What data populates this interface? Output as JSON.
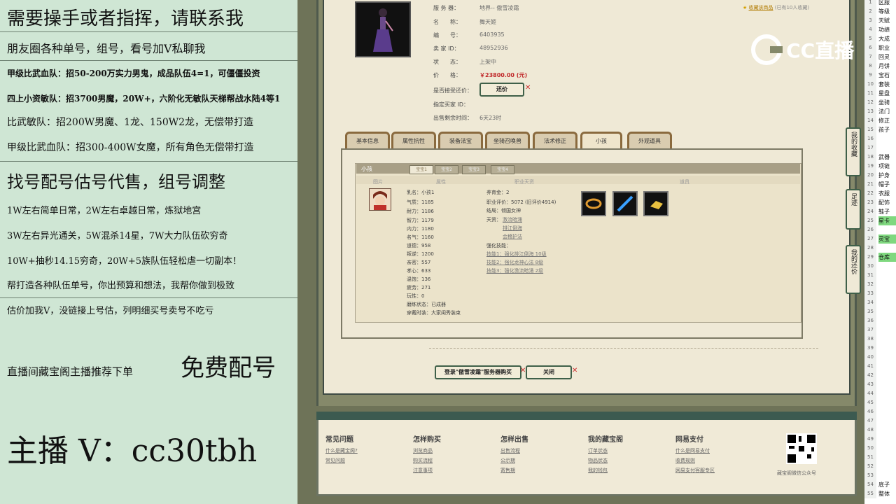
{
  "overlay": {
    "lines": [
      "需要操手或者指挥，请联系我",
      "朋友圈各种单号，组号，看号加V私聊我",
      "甲级比武血队：招50-200万实力男鬼，成品队伍4=1，可僵僵投资",
      "四上小资敏队：招3700男魔，20W+，六阶化无敏队天梯帮战水陆4等1",
      "比武敏队：招200W男魔、1龙、150W2龙，无偿带打造",
      "甲级比武血队：招300-400W女魔，所有角色无偿带打造",
      "找号配号估号代售，组号调整",
      "1W左右简单日常，2W左右卓越日常，炼狱地宫",
      "3W左右异光通关，5W混杀14星，7W大力队伍砍穷奇",
      "10W+抽秒14.15穷奇，20W+5族队伍轻松虐一切副本！",
      "帮打造各种队伍单号，你出预算和想法，我帮你做到极致",
      "估价加我V，没链接上号估，列明细买号卖号不吃亏",
      "直播间藏宝阁主播推荐下单",
      "免费配号",
      "主播 V：cc30tbh"
    ]
  },
  "logo": {
    "text": "CC直播"
  },
  "favorite": {
    "text": "收藏该商品",
    "count": "(已有10人收藏)"
  },
  "info": {
    "server_label": "服 务 器：",
    "server": "地界-- 傲雪凌霜",
    "name_label": "名　　称：",
    "name": "舞天姬",
    "id_label": "编　　号：",
    "id": "6403935",
    "seller_label": "卖 家 ID：",
    "seller": "48952936",
    "status_label": "状　　态：",
    "status": "上架中",
    "price_label": "价　　格：",
    "price": "￥23800.00 (元)",
    "bargain_label": "是否接受还价：",
    "bargain_btn": "还价",
    "buyer_label": "指定买家 ID：",
    "time_label": "出售剩余时间：",
    "time": "6天23时"
  },
  "tabs": [
    "基本信息",
    "属性抗性",
    "装备法宝",
    "坐骑召唤兽",
    "法术修正",
    "小孩",
    "外观道具"
  ],
  "child": {
    "title": "小孩",
    "subtabs": [
      "宝宝1",
      "宝宝2",
      "宝宝3",
      "宝宝4"
    ],
    "cols": [
      "图片",
      "属性",
      "职业天资",
      "道具"
    ],
    "stats": [
      "乳名：小孩1",
      "气质：1185",
      "耐力：1186",
      "智力：1179",
      "内力：1180",
      "名气：1160",
      "道德：958",
      "叛逆：1200",
      "亲密：557",
      "孝心：633",
      "温饱：136",
      "疲劳：271",
      "玩性：0",
      "磨练状态：已成器",
      "穿戴时装：大家闺秀装束"
    ],
    "raise_gold": "养育金：2",
    "career_eval": "职业评价：5072 (旧评价4914)",
    "ending": "结局：倾国女神",
    "talent_label": "天资：",
    "talents": [
      "激流暗涌",
      "排江倒海",
      "会稽护法"
    ],
    "skill_label": "强化技能：",
    "skills": [
      "技能1：强化排江倒海 10级",
      "技能2：强化龙神心法 8级",
      "技能3：强化激流暗涌 2级"
    ]
  },
  "actions": {
    "login": "登录\"傲雪凌霜\"服务器购买",
    "close": "关闭"
  },
  "side_buttons": [
    "我的收藏",
    "足迹",
    "我的还价"
  ],
  "footer": {
    "columns": [
      {
        "title": "常见问题",
        "links": [
          "什么是藏宝阁?",
          "常见问题"
        ]
      },
      {
        "title": "怎样购买",
        "links": [
          "浏览商品",
          "购买流程",
          "注意事项"
        ]
      },
      {
        "title": "怎样出售",
        "links": [
          "出售流程",
          "公示期",
          "寄售期"
        ]
      },
      {
        "title": "我的藏宝阁",
        "links": [
          "订单状态",
          "物品状态",
          "我的钱包"
        ]
      },
      {
        "title": "网易支付",
        "links": [
          "什么是网易支付",
          "收费规则",
          "网易支付客服专区"
        ]
      }
    ],
    "qr_caption": "藏宝阁微信公众号"
  },
  "sheet": {
    "rows": [
      [
        "1",
        "区服"
      ],
      [
        "2",
        "等级"
      ],
      [
        "3",
        "天赋"
      ],
      [
        "4",
        "功绩"
      ],
      [
        "5",
        "大成"
      ],
      [
        "6",
        "职业"
      ],
      [
        "7",
        "回灵"
      ],
      [
        "8",
        "月饼"
      ],
      [
        "9",
        "宝石"
      ],
      [
        "10",
        "套装"
      ],
      [
        "11",
        "星盘"
      ],
      [
        "12",
        "坐骑"
      ],
      [
        "13",
        "法门"
      ],
      [
        "14",
        "修正"
      ],
      [
        "15",
        "孩子"
      ],
      [
        "16",
        ""
      ],
      [
        "17",
        ""
      ],
      [
        "18",
        "武器"
      ],
      [
        "19",
        "项链"
      ],
      [
        "20",
        "护身"
      ],
      [
        "21",
        "帽子"
      ],
      [
        "22",
        "衣服"
      ],
      [
        "23",
        "配饰"
      ],
      [
        "24",
        "鞋子"
      ],
      [
        "25",
        "星卡"
      ],
      [
        "26",
        ""
      ],
      [
        "27",
        "灵宝"
      ],
      [
        "28",
        ""
      ],
      [
        "29",
        "仓库"
      ],
      [
        "30",
        ""
      ],
      [
        "31",
        ""
      ],
      [
        "32",
        ""
      ],
      [
        "33",
        ""
      ],
      [
        "34",
        ""
      ],
      [
        "35",
        ""
      ],
      [
        "36",
        ""
      ],
      [
        "37",
        ""
      ],
      [
        "38",
        ""
      ],
      [
        "39",
        ""
      ],
      [
        "40",
        ""
      ],
      [
        "41",
        ""
      ],
      [
        "42",
        ""
      ],
      [
        "43",
        ""
      ],
      [
        "44",
        ""
      ],
      [
        "45",
        ""
      ],
      [
        "46",
        ""
      ],
      [
        "47",
        ""
      ],
      [
        "48",
        ""
      ],
      [
        "49",
        ""
      ],
      [
        "50",
        ""
      ],
      [
        "51",
        ""
      ],
      [
        "52",
        ""
      ],
      [
        "53",
        ""
      ],
      [
        "54",
        "底子"
      ],
      [
        "55",
        "整体"
      ]
    ]
  }
}
